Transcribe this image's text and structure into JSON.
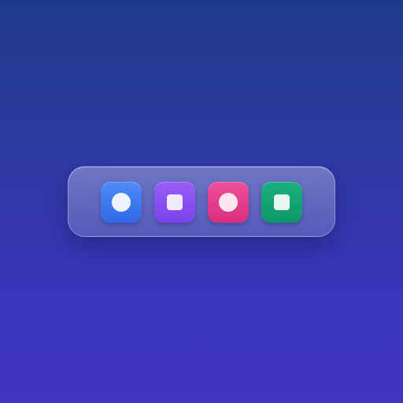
{
  "dock": {
    "items": [
      {
        "icon": "circle-icon",
        "color": "#3a78f0"
      },
      {
        "icon": "square-icon",
        "color": "#8a50f0"
      },
      {
        "icon": "circle-icon",
        "color": "#e63e8a"
      },
      {
        "icon": "square-icon",
        "color": "#14a374"
      }
    ]
  }
}
